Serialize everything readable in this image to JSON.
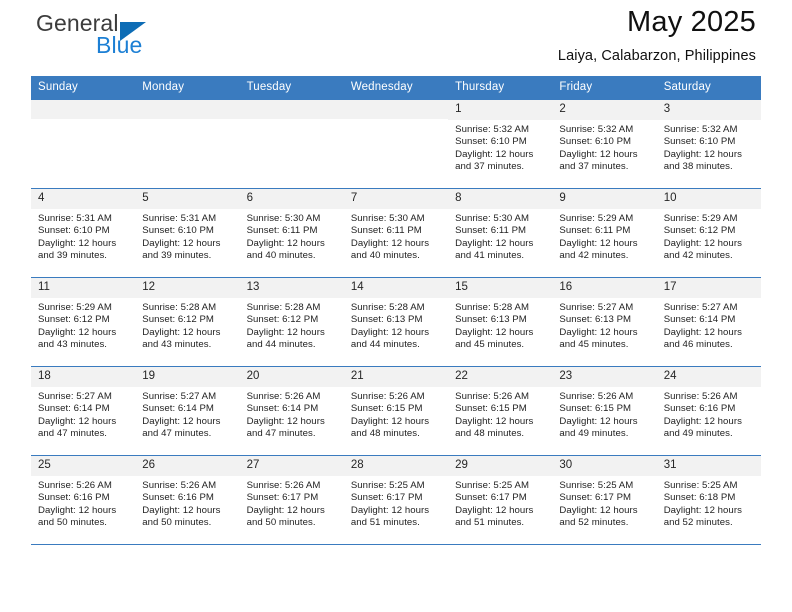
{
  "brand": {
    "name_part1": "General",
    "name_part2": "Blue",
    "accent_color": "#1c7fd4",
    "triangle_color": "#0d6cb5",
    "logo_icon": "triangle-flag-icon"
  },
  "header": {
    "title": "May 2025",
    "subtitle": "Laiya, Calabarzon, Philippines",
    "header_bg_color": "#3a7bbf"
  },
  "weekday_headers": [
    "Sunday",
    "Monday",
    "Tuesday",
    "Wednesday",
    "Thursday",
    "Friday",
    "Saturday"
  ],
  "labels": {
    "sunrise_prefix": "Sunrise:",
    "sunset_prefix": "Sunset:",
    "daylight_prefix": "Daylight:"
  },
  "weeks": [
    [
      {
        "day": "",
        "sunrise": "",
        "sunset": "",
        "daylight_line1": "",
        "daylight_line2": ""
      },
      {
        "day": "",
        "sunrise": "",
        "sunset": "",
        "daylight_line1": "",
        "daylight_line2": ""
      },
      {
        "day": "",
        "sunrise": "",
        "sunset": "",
        "daylight_line1": "",
        "daylight_line2": ""
      },
      {
        "day": "",
        "sunrise": "",
        "sunset": "",
        "daylight_line1": "",
        "daylight_line2": ""
      },
      {
        "day": "1",
        "sunrise": "Sunrise: 5:32 AM",
        "sunset": "Sunset: 6:10 PM",
        "daylight_line1": "Daylight: 12 hours",
        "daylight_line2": "and 37 minutes."
      },
      {
        "day": "2",
        "sunrise": "Sunrise: 5:32 AM",
        "sunset": "Sunset: 6:10 PM",
        "daylight_line1": "Daylight: 12 hours",
        "daylight_line2": "and 37 minutes."
      },
      {
        "day": "3",
        "sunrise": "Sunrise: 5:32 AM",
        "sunset": "Sunset: 6:10 PM",
        "daylight_line1": "Daylight: 12 hours",
        "daylight_line2": "and 38 minutes."
      }
    ],
    [
      {
        "day": "4",
        "sunrise": "Sunrise: 5:31 AM",
        "sunset": "Sunset: 6:10 PM",
        "daylight_line1": "Daylight: 12 hours",
        "daylight_line2": "and 39 minutes."
      },
      {
        "day": "5",
        "sunrise": "Sunrise: 5:31 AM",
        "sunset": "Sunset: 6:10 PM",
        "daylight_line1": "Daylight: 12 hours",
        "daylight_line2": "and 39 minutes."
      },
      {
        "day": "6",
        "sunrise": "Sunrise: 5:30 AM",
        "sunset": "Sunset: 6:11 PM",
        "daylight_line1": "Daylight: 12 hours",
        "daylight_line2": "and 40 minutes."
      },
      {
        "day": "7",
        "sunrise": "Sunrise: 5:30 AM",
        "sunset": "Sunset: 6:11 PM",
        "daylight_line1": "Daylight: 12 hours",
        "daylight_line2": "and 40 minutes."
      },
      {
        "day": "8",
        "sunrise": "Sunrise: 5:30 AM",
        "sunset": "Sunset: 6:11 PM",
        "daylight_line1": "Daylight: 12 hours",
        "daylight_line2": "and 41 minutes."
      },
      {
        "day": "9",
        "sunrise": "Sunrise: 5:29 AM",
        "sunset": "Sunset: 6:11 PM",
        "daylight_line1": "Daylight: 12 hours",
        "daylight_line2": "and 42 minutes."
      },
      {
        "day": "10",
        "sunrise": "Sunrise: 5:29 AM",
        "sunset": "Sunset: 6:12 PM",
        "daylight_line1": "Daylight: 12 hours",
        "daylight_line2": "and 42 minutes."
      }
    ],
    [
      {
        "day": "11",
        "sunrise": "Sunrise: 5:29 AM",
        "sunset": "Sunset: 6:12 PM",
        "daylight_line1": "Daylight: 12 hours",
        "daylight_line2": "and 43 minutes."
      },
      {
        "day": "12",
        "sunrise": "Sunrise: 5:28 AM",
        "sunset": "Sunset: 6:12 PM",
        "daylight_line1": "Daylight: 12 hours",
        "daylight_line2": "and 43 minutes."
      },
      {
        "day": "13",
        "sunrise": "Sunrise: 5:28 AM",
        "sunset": "Sunset: 6:12 PM",
        "daylight_line1": "Daylight: 12 hours",
        "daylight_line2": "and 44 minutes."
      },
      {
        "day": "14",
        "sunrise": "Sunrise: 5:28 AM",
        "sunset": "Sunset: 6:13 PM",
        "daylight_line1": "Daylight: 12 hours",
        "daylight_line2": "and 44 minutes."
      },
      {
        "day": "15",
        "sunrise": "Sunrise: 5:28 AM",
        "sunset": "Sunset: 6:13 PM",
        "daylight_line1": "Daylight: 12 hours",
        "daylight_line2": "and 45 minutes."
      },
      {
        "day": "16",
        "sunrise": "Sunrise: 5:27 AM",
        "sunset": "Sunset: 6:13 PM",
        "daylight_line1": "Daylight: 12 hours",
        "daylight_line2": "and 45 minutes."
      },
      {
        "day": "17",
        "sunrise": "Sunrise: 5:27 AM",
        "sunset": "Sunset: 6:14 PM",
        "daylight_line1": "Daylight: 12 hours",
        "daylight_line2": "and 46 minutes."
      }
    ],
    [
      {
        "day": "18",
        "sunrise": "Sunrise: 5:27 AM",
        "sunset": "Sunset: 6:14 PM",
        "daylight_line1": "Daylight: 12 hours",
        "daylight_line2": "and 47 minutes."
      },
      {
        "day": "19",
        "sunrise": "Sunrise: 5:27 AM",
        "sunset": "Sunset: 6:14 PM",
        "daylight_line1": "Daylight: 12 hours",
        "daylight_line2": "and 47 minutes."
      },
      {
        "day": "20",
        "sunrise": "Sunrise: 5:26 AM",
        "sunset": "Sunset: 6:14 PM",
        "daylight_line1": "Daylight: 12 hours",
        "daylight_line2": "and 47 minutes."
      },
      {
        "day": "21",
        "sunrise": "Sunrise: 5:26 AM",
        "sunset": "Sunset: 6:15 PM",
        "daylight_line1": "Daylight: 12 hours",
        "daylight_line2": "and 48 minutes."
      },
      {
        "day": "22",
        "sunrise": "Sunrise: 5:26 AM",
        "sunset": "Sunset: 6:15 PM",
        "daylight_line1": "Daylight: 12 hours",
        "daylight_line2": "and 48 minutes."
      },
      {
        "day": "23",
        "sunrise": "Sunrise: 5:26 AM",
        "sunset": "Sunset: 6:15 PM",
        "daylight_line1": "Daylight: 12 hours",
        "daylight_line2": "and 49 minutes."
      },
      {
        "day": "24",
        "sunrise": "Sunrise: 5:26 AM",
        "sunset": "Sunset: 6:16 PM",
        "daylight_line1": "Daylight: 12 hours",
        "daylight_line2": "and 49 minutes."
      }
    ],
    [
      {
        "day": "25",
        "sunrise": "Sunrise: 5:26 AM",
        "sunset": "Sunset: 6:16 PM",
        "daylight_line1": "Daylight: 12 hours",
        "daylight_line2": "and 50 minutes."
      },
      {
        "day": "26",
        "sunrise": "Sunrise: 5:26 AM",
        "sunset": "Sunset: 6:16 PM",
        "daylight_line1": "Daylight: 12 hours",
        "daylight_line2": "and 50 minutes."
      },
      {
        "day": "27",
        "sunrise": "Sunrise: 5:26 AM",
        "sunset": "Sunset: 6:17 PM",
        "daylight_line1": "Daylight: 12 hours",
        "daylight_line2": "and 50 minutes."
      },
      {
        "day": "28",
        "sunrise": "Sunrise: 5:25 AM",
        "sunset": "Sunset: 6:17 PM",
        "daylight_line1": "Daylight: 12 hours",
        "daylight_line2": "and 51 minutes."
      },
      {
        "day": "29",
        "sunrise": "Sunrise: 5:25 AM",
        "sunset": "Sunset: 6:17 PM",
        "daylight_line1": "Daylight: 12 hours",
        "daylight_line2": "and 51 minutes."
      },
      {
        "day": "30",
        "sunrise": "Sunrise: 5:25 AM",
        "sunset": "Sunset: 6:17 PM",
        "daylight_line1": "Daylight: 12 hours",
        "daylight_line2": "and 52 minutes."
      },
      {
        "day": "31",
        "sunrise": "Sunrise: 5:25 AM",
        "sunset": "Sunset: 6:18 PM",
        "daylight_line1": "Daylight: 12 hours",
        "daylight_line2": "and 52 minutes."
      }
    ]
  ]
}
